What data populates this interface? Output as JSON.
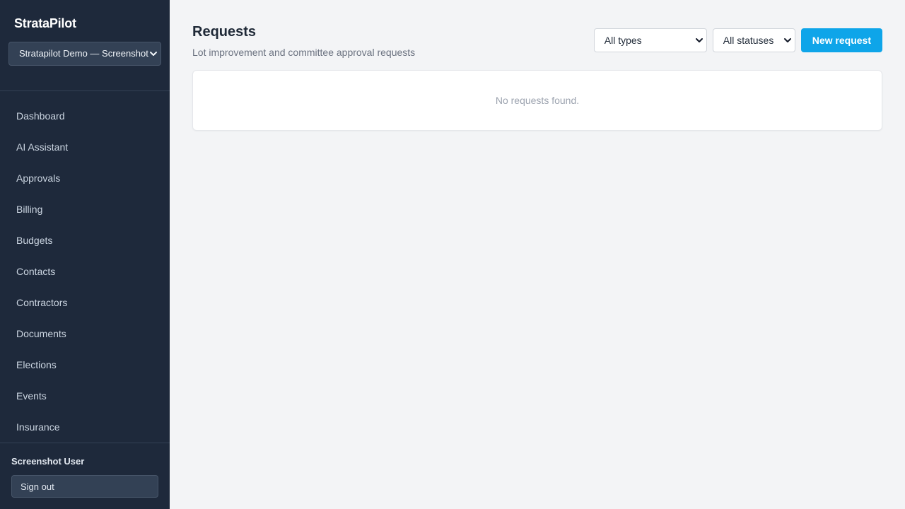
{
  "app": {
    "name": "StrataPilot"
  },
  "org_selector": {
    "value": "Stratapilot Demo — Screenshot"
  },
  "sidebar": {
    "items": [
      {
        "label": "Dashboard"
      },
      {
        "label": "AI Assistant"
      },
      {
        "label": "Approvals"
      },
      {
        "label": "Billing"
      },
      {
        "label": "Budgets"
      },
      {
        "label": "Contacts"
      },
      {
        "label": "Contractors"
      },
      {
        "label": "Documents"
      },
      {
        "label": "Elections"
      },
      {
        "label": "Events"
      },
      {
        "label": "Insurance"
      }
    ]
  },
  "user": {
    "name": "Screenshot User",
    "signout_label": "Sign out"
  },
  "page": {
    "title": "Requests",
    "subtitle": "Lot improvement and committee approval requests"
  },
  "filters": {
    "type": {
      "selected": "All types"
    },
    "status": {
      "selected": "All statuses"
    }
  },
  "actions": {
    "new_request_label": "New request"
  },
  "results": {
    "empty_message": "No requests found."
  },
  "colors": {
    "sidebar_bg": "#1e293b",
    "accent": "#0ea5e9",
    "page_bg": "#f3f4f6"
  },
  "icons": {
    "dropdown": "chevron-down-icon"
  }
}
